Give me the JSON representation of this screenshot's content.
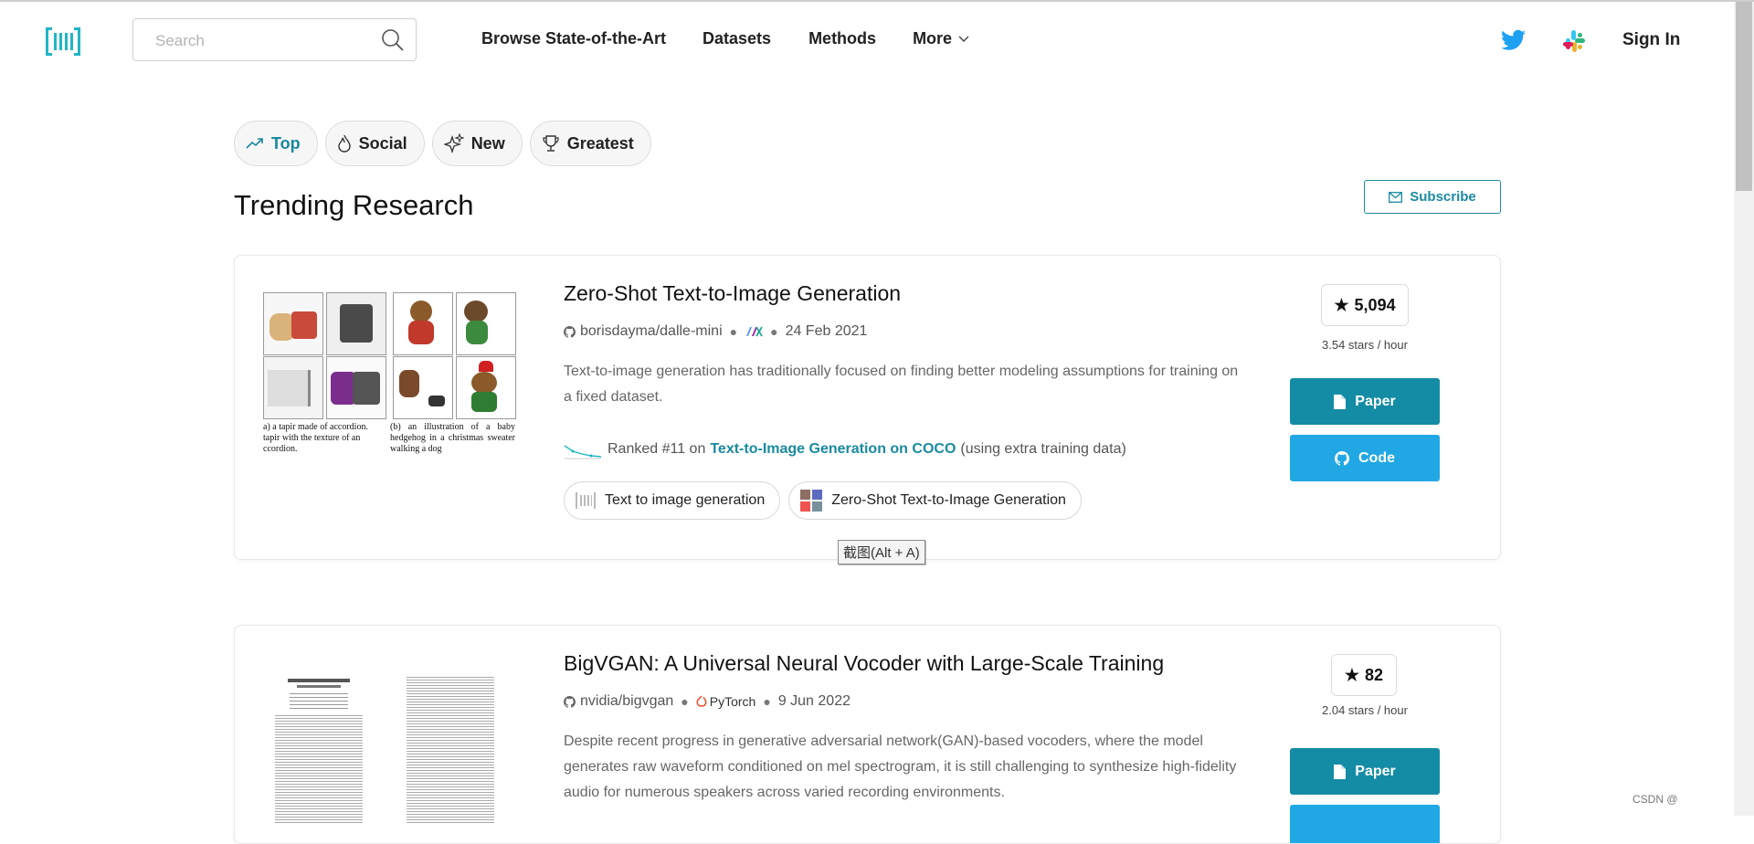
{
  "header": {
    "search_placeholder": "Search",
    "nav": [
      "Browse State-of-the-Art",
      "Datasets",
      "Methods",
      "More"
    ],
    "sign_in": "Sign In"
  },
  "tabs": [
    {
      "label": "Top",
      "icon": "trending-icon",
      "active": true
    },
    {
      "label": "Social",
      "icon": "flame-icon",
      "active": false
    },
    {
      "label": "New",
      "icon": "sparkle-icon",
      "active": false
    },
    {
      "label": "Greatest",
      "icon": "trophy-icon",
      "active": false
    }
  ],
  "page": {
    "title": "Trending Research",
    "subscribe": "Subscribe"
  },
  "papers": [
    {
      "title": "Zero-Shot Text-to-Image Generation",
      "repo": "borisdayma/dalle-mini",
      "date": "24 Feb 2021",
      "abstract": "Text-to-image generation has traditionally focused on finding better modeling assumptions for training on a fixed dataset.",
      "rank_prefix": "Ranked #11 on",
      "rank_task": "Text-to-Image Generation on COCO",
      "rank_suffix": "(using extra training data)",
      "tags": [
        "Text to image generation",
        "Zero-Shot Text-to-Image Generation"
      ],
      "stars": "5,094",
      "rate": "3.54 stars / hour",
      "paper_btn": "Paper",
      "code_btn": "Code",
      "thumb_caption_a": "a) a tapir made of accordion. tapir with the texture of an ccordion.",
      "thumb_caption_b": "(b) an illustration of a baby hedgehog in a christmas sweater walking a dog"
    },
    {
      "title": "BigVGAN: A Universal Neural Vocoder with Large-Scale Training",
      "repo": "nvidia/bigvgan",
      "framework": "PyTorch",
      "date": "9 Jun 2022",
      "abstract": "Despite recent progress in generative adversarial network(GAN)-based vocoders, where the model generates raw waveform conditioned on mel spectrogram, it is still challenging to synthesize high-fidelity audio for numerous speakers across varied recording environments.",
      "stars": "82",
      "rate": "2.04 stars / hour",
      "paper_btn": "Paper"
    }
  ],
  "tooltip": "截图(Alt + A)",
  "watermark": "CSDN @",
  "colors": {
    "accent": "#158ca5",
    "code": "#21a8e4",
    "link": "#1a8aa1"
  }
}
